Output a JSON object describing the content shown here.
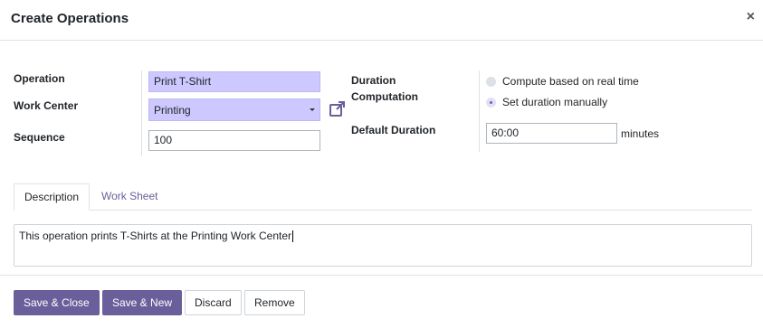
{
  "dialog": {
    "title": "Create Operations",
    "close_glyph": "×"
  },
  "form": {
    "operation": {
      "label": "Operation",
      "value": "Print T-Shirt"
    },
    "work_center": {
      "label": "Work Center",
      "value": "Printing"
    },
    "sequence": {
      "label": "Sequence",
      "value": "100"
    },
    "duration_computation": {
      "label_line1": "Duration",
      "label_line2": "Computation",
      "options": [
        {
          "label": "Compute based on real time",
          "checked": false
        },
        {
          "label": "Set duration manually",
          "checked": true
        }
      ]
    },
    "default_duration": {
      "label": "Default Duration",
      "value": "60:00",
      "unit": "minutes"
    }
  },
  "tabs": [
    {
      "label": "Description",
      "active": true
    },
    {
      "label": "Work Sheet",
      "active": false
    }
  ],
  "description_text": "This operation prints T-Shirts at the Printing Work Center",
  "footer": {
    "save_close": "Save & Close",
    "save_new": "Save & New",
    "discard": "Discard",
    "remove": "Remove"
  },
  "colors": {
    "primary": "#6a5f9b",
    "required_field": "#cdc8ff",
    "tab_inactive": "#6b5e9b"
  },
  "icons": {
    "close": "close-icon",
    "external_link": "external-link-icon",
    "select_caret": "caret-down-icon"
  }
}
